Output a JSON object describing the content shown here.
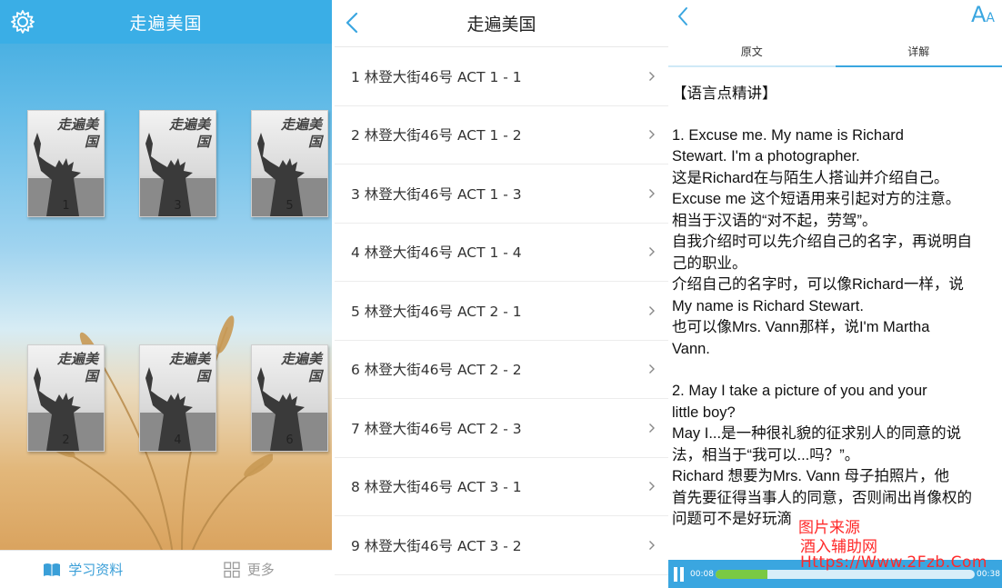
{
  "shelf": {
    "title": "走遍美国",
    "book_cover_title": "走遍美国",
    "books": [
      "1",
      "3",
      "5",
      "2",
      "4",
      "6"
    ],
    "tabs": {
      "study": "学习资料",
      "more": "更多"
    }
  },
  "episodes": {
    "title": "走遍美国",
    "items": [
      "1 林登大街46号 ACT 1 - 1",
      "2 林登大街46号 ACT 1 - 2",
      "3 林登大街46号 ACT 1 - 3",
      "4 林登大街46号 ACT 1 - 4",
      "5 林登大街46号 ACT 2 - 1",
      "6 林登大街46号 ACT 2 - 2",
      "7 林登大街46号 ACT 2 - 3",
      "8 林登大街46号 ACT 3 - 1",
      "9 林登大街46号 ACT 3 - 2"
    ]
  },
  "detail": {
    "font_button": {
      "big": "A",
      "small": "A"
    },
    "tabs": {
      "original": "原文",
      "explain": "详解"
    },
    "heading": "【语言点精讲】",
    "para1": [
      "1. Excuse me. My name is Richard",
      "Stewart. I'm a photographer.",
      "这是Richard在与陌生人搭讪并介绍自己。",
      "Excuse me 这个短语用来引起对方的注意。",
      "相当于汉语的“对不起，劳驾”。",
      "自我介绍时可以先介绍自己的名字，再说明自",
      "己的职业。",
      "介绍自己的名字时，可以像Richard一样，说",
      "My name is Richard Stewart.",
      "也可以像Mrs. Vann那样，说I'm Martha",
      "Vann."
    ],
    "para2": [
      "2. May I take a picture of you and your",
      "little boy?",
      "May I...是一种很礼貌的征求别人的同意的说",
      "法，相当于“我可以...吗？”。",
      "Richard 想要为Mrs. Vann 母子拍照片，他",
      "首先要征得当事人的同意，否则闹出肖像权的",
      "问题可不是好玩滴"
    ],
    "player": {
      "elapsed": "00:08",
      "total": "00:38",
      "progress": 0.2
    }
  },
  "watermark": {
    "line1": "图片来源",
    "line2": "酒入辅助网",
    "line3": "Https://Www.2Fzb.Com"
  },
  "colors": {
    "accent": "#3aa6e0",
    "header": "#3aaee6",
    "watermark": "#ff2a2a",
    "progress_fill": "#7ac943"
  }
}
